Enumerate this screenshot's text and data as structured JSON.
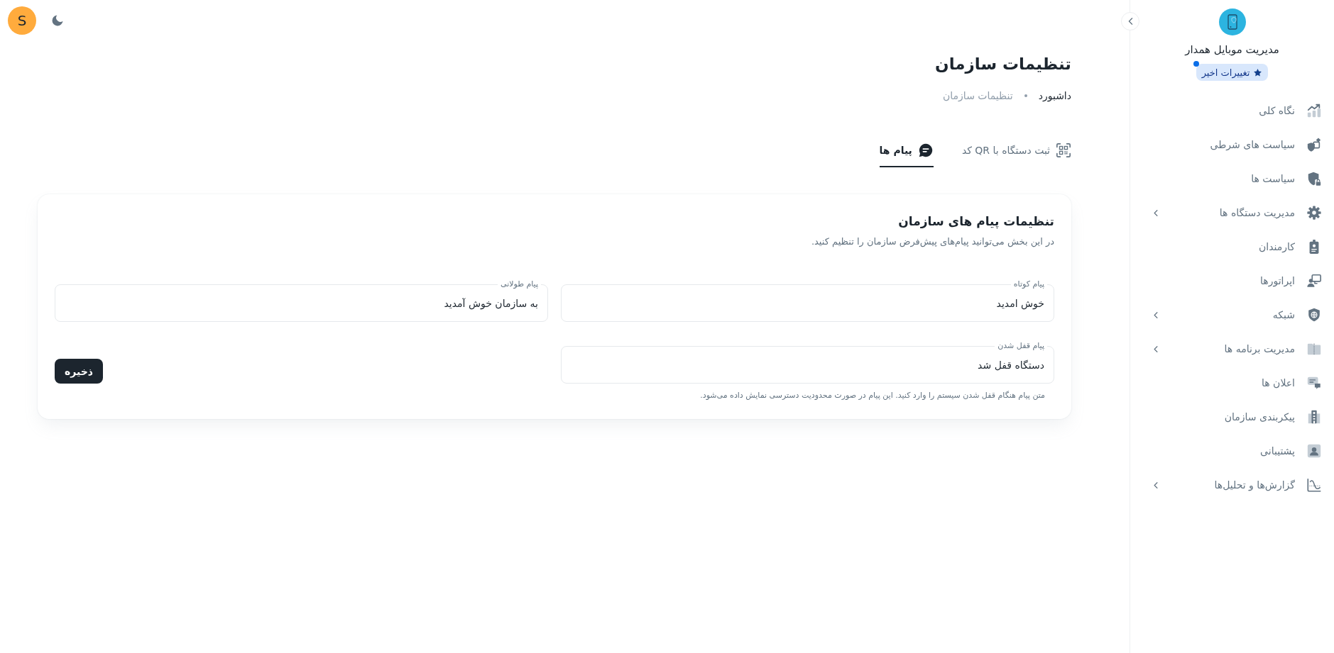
{
  "top_bar": {
    "avatar_initial": "S"
  },
  "sidebar": {
    "app_title": "مدیریت موبایل همدار",
    "badge": {
      "label": "تغییرات اخیر",
      "unread": true
    },
    "items": [
      {
        "label": "نگاه کلی",
        "submenu": false,
        "selected": false
      },
      {
        "label": "سیاست های شرطی",
        "submenu": false,
        "selected": false
      },
      {
        "label": "سیاست ها",
        "submenu": false,
        "selected": false
      },
      {
        "label": "مدیریت دستگاه ها",
        "submenu": true,
        "selected": false
      },
      {
        "label": "کارمندان",
        "submenu": false,
        "selected": false
      },
      {
        "label": "اپراتورها",
        "submenu": false,
        "selected": false
      },
      {
        "label": "شبکه",
        "submenu": true,
        "selected": false
      },
      {
        "label": "مدیریت برنامه ها",
        "submenu": true,
        "selected": false
      },
      {
        "label": "اعلان ها",
        "submenu": false,
        "selected": false
      },
      {
        "label": "پیکربندی سازمان",
        "submenu": false,
        "selected": false
      },
      {
        "label": "پشتیبانی",
        "submenu": false,
        "selected": false
      },
      {
        "label": "گزارش‌ها و تحلیل‌ها",
        "submenu": true,
        "selected": false
      }
    ]
  },
  "page": {
    "title": "تنظیمات سازمان",
    "breadcrumb": [
      {
        "label": "داشبورد",
        "current": false
      },
      {
        "label": "تنظیمات سازمان",
        "current": true
      }
    ]
  },
  "tabs": [
    {
      "label": "ثبت دستگاه با QR کد",
      "selected": false
    },
    {
      "label": "پیام ها",
      "selected": true
    }
  ],
  "card": {
    "title": "تنظیمات پیام های سازمان",
    "description": "در این بخش می‌توانید پیام‌های پیش‌فرض سازمان را تنظیم کنید.",
    "fields": [
      {
        "label": "پیام کوتاه",
        "value": "خوش امدید"
      },
      {
        "label": "پیام طولانی",
        "value": "به سازمان خوش آمدید"
      },
      {
        "label": "پیام قفل شدن",
        "value": "دستگاه قفل شد",
        "helper": "متن پیام هنگام قفل شدن سیستم را وارد کنید. این پیام در صورت محدودیت دسترسی نمایش داده می‌شود."
      }
    ],
    "save_button": "ذخیره"
  }
}
